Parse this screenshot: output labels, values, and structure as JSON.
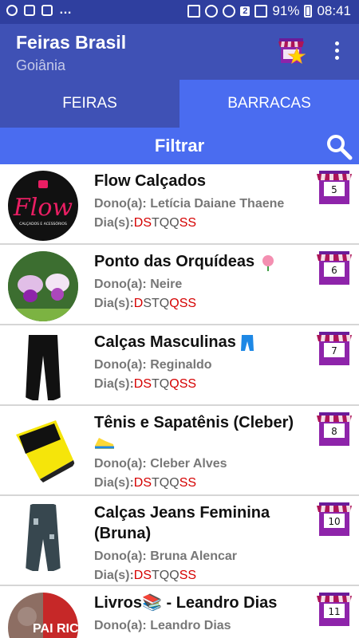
{
  "status_bar": {
    "battery": "91%",
    "time": "08:41",
    "sim": "2"
  },
  "app_bar": {
    "title": "Feiras Brasil",
    "subtitle": "Goiânia"
  },
  "tabs": [
    {
      "label": "FEIRAS"
    },
    {
      "label": "BARRACAS"
    }
  ],
  "filter": {
    "label": "Filtrar"
  },
  "owner_prefix": "Dono(a):",
  "days_prefix": "Dia(s):",
  "stalls": [
    {
      "name": "Flow Calçados",
      "owner": "Letícia Daiane Thaene",
      "number": "5",
      "avatar_text": "Flow",
      "avatar_sub": "CALÇADOS E ACESSÓRIOS"
    },
    {
      "name": "Ponto das Orquídeas",
      "owner": "Neire",
      "number": "6"
    },
    {
      "name": "Calças Masculinas",
      "owner": "Reginaldo",
      "number": "7"
    },
    {
      "name": "Tênis e Sapatênis (Cleber)",
      "owner": "Cleber Alves",
      "number": "8"
    },
    {
      "name": "Calças Jeans Feminina (Bruna)",
      "owner": "Bruna Alencar",
      "number": "10"
    },
    {
      "name": "Livros📚 - Leandro Dias",
      "owner": "Leandro Dias",
      "number": "11",
      "avatar_text": "PAI RICO"
    }
  ]
}
